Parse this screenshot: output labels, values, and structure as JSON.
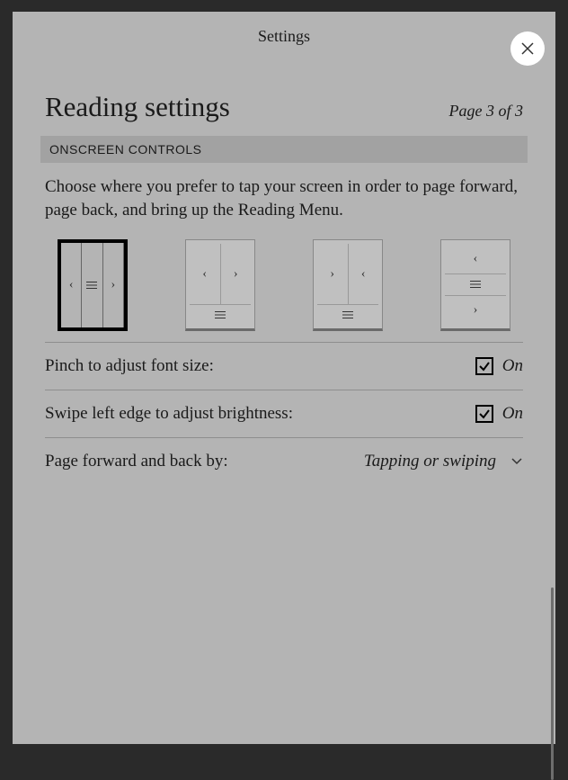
{
  "header": {
    "title": "Settings"
  },
  "section": {
    "title": "Reading settings",
    "page_indicator": "Page 3 of 3",
    "subheader": "ONSCREEN CONTROLS",
    "description": "Choose where you prefer to tap your screen in order to page forward, page back, and bring up the Reading Menu."
  },
  "layouts": {
    "selected_index": 0,
    "options": [
      {
        "name": "back-menu-forward-columns"
      },
      {
        "name": "back-forward-columns-menu-bottom"
      },
      {
        "name": "forward-back-columns-menu-bottom"
      },
      {
        "name": "back-menu-forward-rows"
      }
    ]
  },
  "settings": {
    "pinch_label": "Pinch to adjust font size:",
    "pinch_state": "On",
    "swipe_label": "Swipe left edge to adjust brightness:",
    "swipe_state": "On",
    "pagefwd_label": "Page forward and back by:",
    "pagefwd_value": "Tapping or swiping"
  },
  "icons": {
    "close": "close-icon",
    "chevron_down": "chevron-down-icon",
    "check": "check-icon"
  }
}
